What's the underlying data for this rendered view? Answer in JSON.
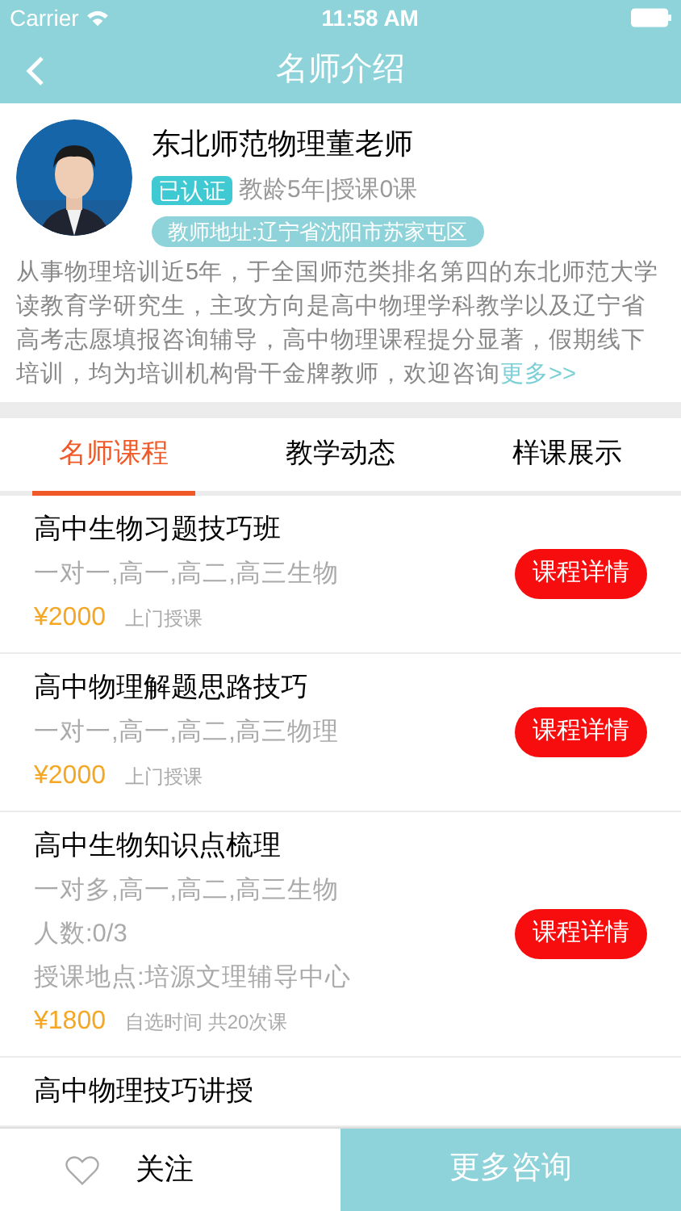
{
  "status_bar": {
    "carrier": "Carrier",
    "time": "11:58 AM"
  },
  "nav": {
    "title": "名师介绍"
  },
  "teacher": {
    "name": "东北师范物理董老师",
    "verified": "已认证",
    "stats": "教龄5年|授课0课",
    "address": "教师地址:辽宁省沈阳市苏家屯区",
    "bio": "从事物理培训近5年，于全国师范类排名第四的东北师范大学读教育学研究生，主攻方向是高中物理学科教学以及辽宁省高考志愿填报咨询辅导，高中物理课程提分显著，假期线下培训，均为培训机构骨干金牌教师，欢迎咨询",
    "more": "更多>>"
  },
  "tabs": [
    {
      "label": "名师课程",
      "selected": true
    },
    {
      "label": "教学动态",
      "selected": false
    },
    {
      "label": "样课展示",
      "selected": false
    }
  ],
  "courses": [
    {
      "title": "高中生物习题技巧班",
      "details": [
        "一对一,高一,高二,高三生物"
      ],
      "price": "¥2000",
      "note": "上门授课",
      "button": "课程详情"
    },
    {
      "title": "高中物理解题思路技巧",
      "details": [
        "一对一,高一,高二,高三物理"
      ],
      "price": "¥2000",
      "note": "上门授课",
      "button": "课程详情"
    },
    {
      "title": "高中生物知识点梳理",
      "details": [
        "一对多,高一,高二,高三生物",
        "人数:0/3",
        "授课地点:培源文理辅导中心"
      ],
      "price": "¥1800",
      "note": "自选时间 共20次课",
      "button": "课程详情"
    },
    {
      "title": "高中物理技巧讲授"
    }
  ],
  "bottom_bar": {
    "follow": "关注",
    "followed": false,
    "consult": "更多咨询"
  }
}
